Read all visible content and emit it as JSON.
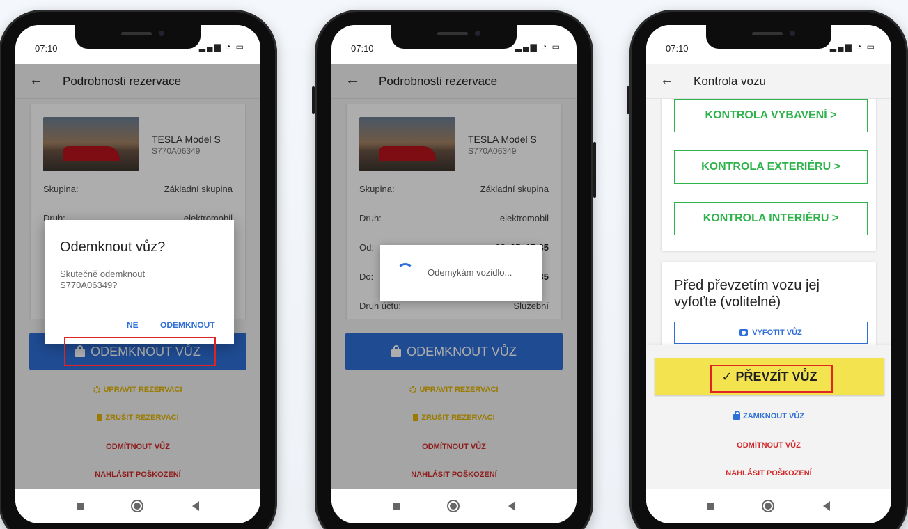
{
  "phones": [
    {
      "status": {
        "time": "07:10"
      },
      "appbar": {
        "title": "Podrobnosti rezervace"
      },
      "card": {
        "car_name": "TESLA Model S",
        "car_plate": "S770A06349",
        "rows": [
          {
            "label": "Skupina:",
            "value": "Základní skupina"
          },
          {
            "label": "Druh:",
            "value": "elektromobil"
          }
        ]
      },
      "dialog": {
        "title": "Odemknout vůz?",
        "message": "Skutečně odemknout S770A06349?",
        "cancel": "NE",
        "confirm": "ODEMKNOUT"
      },
      "actions": {
        "unlock": "ODEMKNOUT VŮZ",
        "edit": "UPRAVIT REZERVACI",
        "cancel": "ZRUŠIT REZERVACI",
        "reject": "ODMÍTNOUT VŮZ",
        "report": "NAHLÁSIT POŠKOZENÍ"
      }
    },
    {
      "status": {
        "time": "07:10"
      },
      "appbar": {
        "title": "Podrobnosti rezervace"
      },
      "card": {
        "car_name": "TESLA Model S",
        "car_plate": "S770A06349",
        "rows": [
          {
            "label": "Skupina:",
            "value": "Základní skupina"
          },
          {
            "label": "Druh:",
            "value": "elektromobil"
          },
          {
            "label": "Od:",
            "value": "03. 05. 17:35"
          },
          {
            "label": "Do:",
            "value": "1:35"
          },
          {
            "label": "Druh účtu:",
            "value": "Služební"
          }
        ]
      },
      "progress": {
        "text": "Odemykám vozidlo..."
      },
      "actions": {
        "unlock": "ODEMKNOUT VŮZ",
        "edit": "UPRAVIT REZERVACI",
        "cancel": "ZRUŠIT REZERVACI",
        "reject": "ODMÍTNOUT VŮZ",
        "report": "NAHLÁSIT POŠKOZENÍ"
      }
    },
    {
      "status": {
        "time": "07:10"
      },
      "appbar": {
        "title": "Kontrola vozu"
      },
      "checks": [
        {
          "label": "KONTROLA VYBAVENÍ >"
        },
        {
          "label": "KONTROLA EXTERIÉRU >"
        },
        {
          "label": "KONTROLA INTERIÉRU >"
        }
      ],
      "photo": {
        "title": "Před převzetím vozu jej vyfoťte (volitelné)",
        "button": "VYFOTIT VŮZ"
      },
      "actions": {
        "take": "✓ PŘEVZÍT VŮZ",
        "lock": "ZAMKNOUT VŮZ",
        "reject": "ODMÍTNOUT VŮZ",
        "report": "NAHLÁSIT POŠKOZENÍ"
      }
    }
  ],
  "colors": {
    "primary_blue": "#2f6fd8",
    "accent_green": "#2eb34b",
    "warning_yellow": "#e3b400",
    "danger_red": "#d12a2a",
    "highlight": "#e02424"
  }
}
